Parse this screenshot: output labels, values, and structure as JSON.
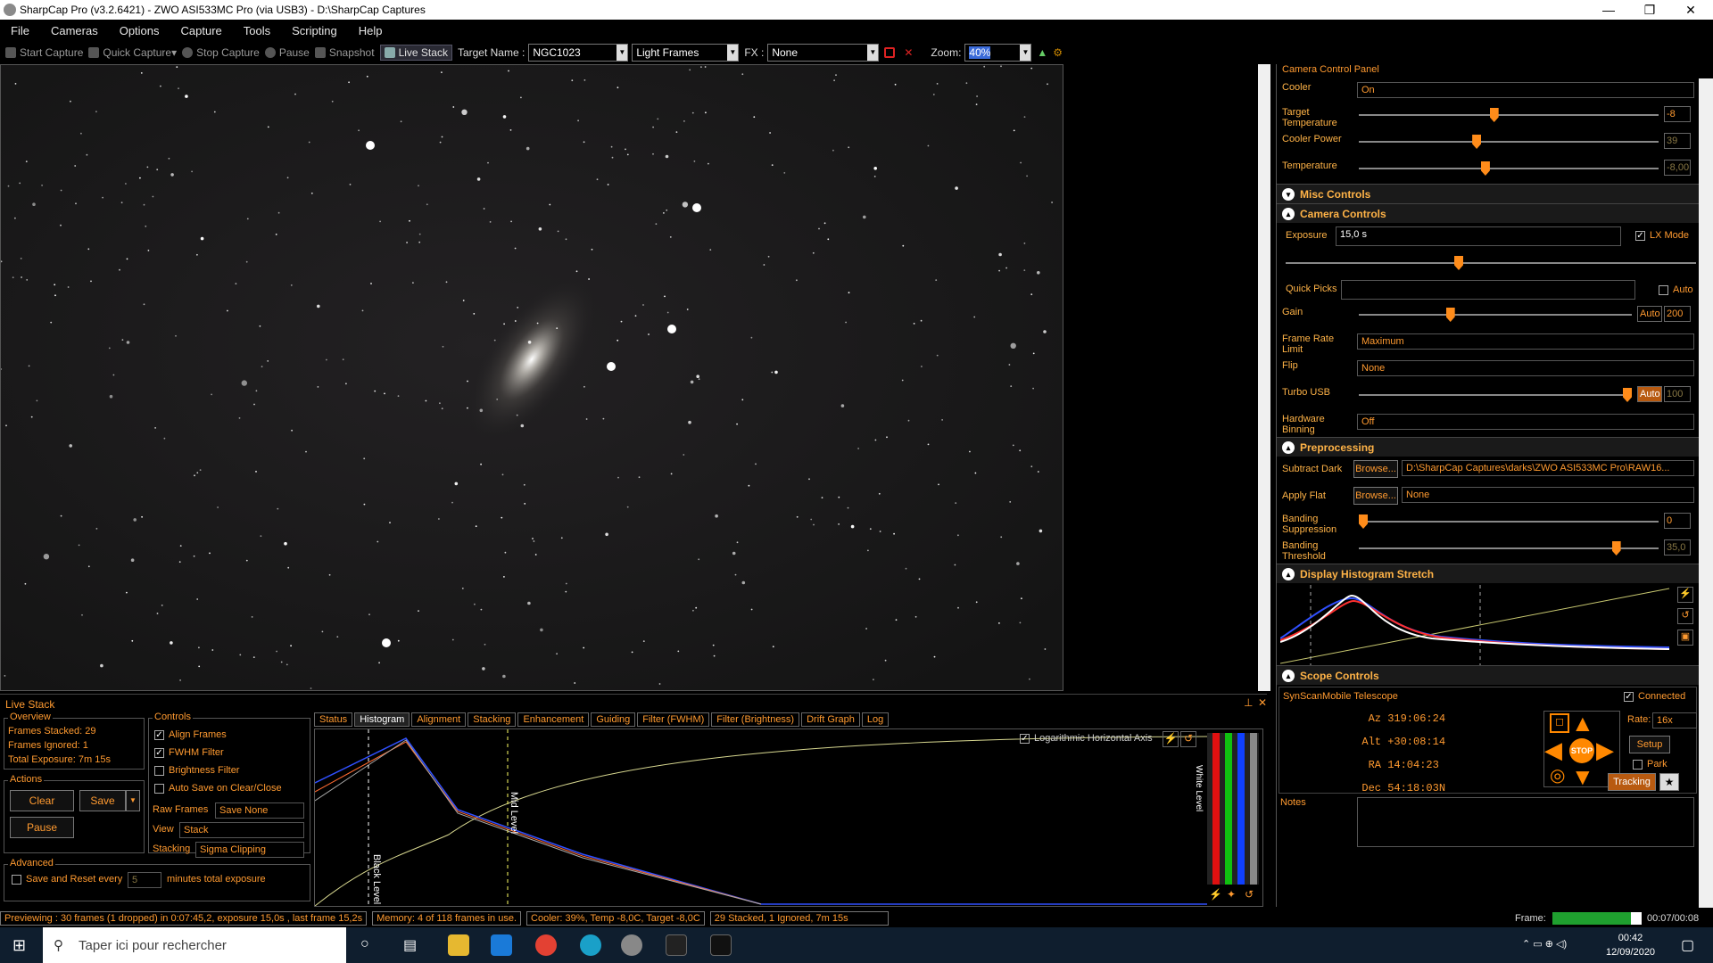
{
  "window": {
    "title": "SharpCap Pro (v3.2.6421) - ZWO ASI533MC Pro (via USB3) - D:\\SharpCap Captures",
    "min": "—",
    "max": "❐",
    "close": "✕"
  },
  "menu": [
    "File",
    "Cameras",
    "Options",
    "Capture",
    "Tools",
    "Scripting",
    "Help"
  ],
  "toolbar": {
    "start_capture": "Start Capture",
    "quick_capture": "Quick Capture",
    "stop_capture": "Stop Capture",
    "pause": "Pause",
    "snapshot": "Snapshot",
    "live_stack": "Live Stack",
    "target_name_label": "Target Name :",
    "target_name": "NGC1023",
    "frame_type": "Light Frames",
    "fx_label": "FX :",
    "fx_value": "None",
    "zoom_label": "Zoom:",
    "zoom_value": "40%"
  },
  "camera_panel": {
    "title": "Camera Control Panel",
    "cooler_label": "Cooler",
    "cooler_value": "On",
    "target_temp_label": "Target Temperature",
    "target_temp_value": "-8",
    "target_temp_level": 0.45,
    "cooler_power_label": "Cooler Power",
    "cooler_power_value": "39",
    "cooler_power_level": 0.39,
    "temperature_label": "Temperature",
    "temperature_value": "-8,00",
    "temperature_level": 0.42,
    "misc_controls": "Misc Controls",
    "camera_controls": "Camera Controls",
    "exposure_label": "Exposure",
    "exposure_value": "15,0 s",
    "lx_mode": "LX Mode",
    "exposure_level": 0.42,
    "quick_picks_label": "Quick Picks",
    "auto_label": "Auto",
    "gain_label": "Gain",
    "gain_auto": "Auto",
    "gain_value": "200",
    "gain_level": 0.33,
    "frame_rate_label": "Frame Rate Limit",
    "frame_rate_value": "Maximum",
    "flip_label": "Flip",
    "flip_value": "None",
    "turbo_label": "Turbo USB",
    "turbo_auto": "Auto",
    "turbo_value": "100",
    "turbo_level": 1.0,
    "binning_label": "Hardware Binning",
    "binning_value": "Off",
    "preprocessing": "Preprocessing",
    "subtract_dark_label": "Subtract Dark",
    "browse": "Browse...",
    "subtract_dark_value": "D:\\SharpCap Captures\\darks\\ZWO ASI533MC Pro\\RAW16...",
    "apply_flat_label": "Apply Flat",
    "apply_flat_value": "None",
    "banding_supp_label": "Banding Suppression",
    "banding_supp_value": "0",
    "banding_supp_level": 0.0,
    "banding_thr_label": "Banding Threshold",
    "banding_thr_value": "35,0",
    "banding_thr_level": 0.87,
    "display_stretch": "Display Histogram Stretch",
    "scope_controls": "Scope Controls",
    "telescope": "SynScanMobile Telescope",
    "connected": "Connected",
    "az_label": "Az",
    "az": "319:06:24",
    "alt_label": "Alt",
    "alt": "+30:08:14",
    "ra_label": "RA",
    "ra": "14:04:23",
    "dec_label": "Dec",
    "dec": "54:18:03N",
    "rate_label": "Rate:",
    "rate_value": "16x",
    "setup": "Setup",
    "park": "Park",
    "stop": "STOP",
    "tracking": "Tracking",
    "notes": "Notes"
  },
  "live_stack": {
    "title": "Live Stack",
    "overview": "Overview",
    "frames_stacked": "Frames Stacked: 29",
    "frames_ignored": "Frames Ignored:  1",
    "total_exposure": "Total Exposure:  7m 15s",
    "actions": "Actions",
    "clear": "Clear",
    "save": "Save",
    "pause": "Pause",
    "controls": "Controls",
    "align_frames": "Align Frames",
    "fwhm_filter": "FWHM Filter",
    "brightness_filter": "Brightness Filter",
    "auto_save": "Auto Save on Clear/Close",
    "raw_frames_label": "Raw Frames",
    "raw_frames_value": "Save None",
    "view_label": "View",
    "view_value": "Stack",
    "stacking_label": "Stacking",
    "stacking_value": "Sigma Clipping",
    "advanced": "Advanced",
    "save_reset": "Save and Reset every",
    "save_reset_value": "5",
    "save_reset_suffix": "minutes total exposure",
    "tabs": [
      "Status",
      "Histogram",
      "Alignment",
      "Stacking",
      "Enhancement",
      "Guiding",
      "Filter (FWHM)",
      "Filter (Brightness)",
      "Drift Graph",
      "Log"
    ],
    "log_axis": "Logarithmic Horizontal Axis",
    "black_level": "Black Level",
    "mid_level": "Mid Level",
    "white_level": "White Level"
  },
  "statusbar": {
    "preview": "Previewing : 30 frames (1 dropped) in 0:07:45,2, exposure 15,0s , last frame 15,2s",
    "memory": "Memory: 4 of 118 frames in use.",
    "cooler": "Cooler: 39%, Temp -8,0C, Target -8,0C",
    "stacked": "29 Stacked, 1 Ignored, 7m 15s",
    "frame_label": "Frame:",
    "frame_time": "00:07/00:08",
    "frame_progress": 0.875
  },
  "taskbar": {
    "search": "Taper ici pour rechercher",
    "time": "00:42",
    "date": "12/09/2020"
  }
}
